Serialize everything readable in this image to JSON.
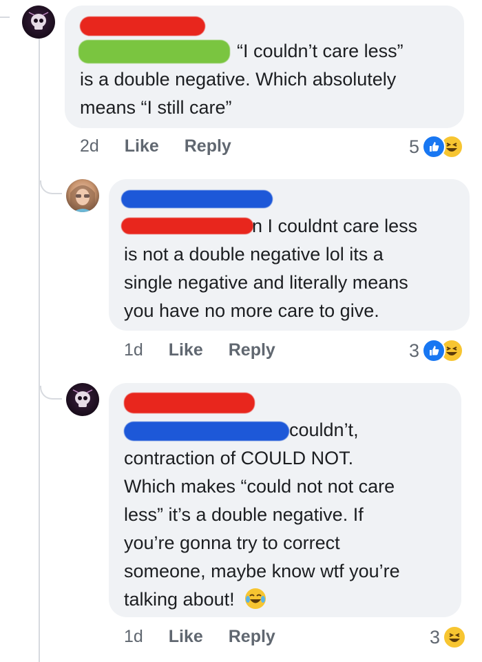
{
  "comments": [
    {
      "text_lines": [
        "“I couldn’t care less”",
        "is a double negative. Which absolutely",
        "means “I still care”"
      ],
      "time": "2d",
      "like_label": "Like",
      "reply_label": "Reply",
      "reaction_count": "5",
      "reactions": [
        "like-icon",
        "haha-icon"
      ]
    },
    {
      "text_lines": [
        "n I couldnt care less",
        "is not a double negative lol its a",
        "single negative and literally means",
        "you have no more care to give."
      ],
      "time": "1d",
      "like_label": "Like",
      "reply_label": "Reply",
      "reaction_count": "3",
      "reactions": [
        "like-icon",
        "haha-icon"
      ]
    },
    {
      "text_lines": [
        "couldn’t,",
        "contraction of COULD NOT.",
        "Which makes “could not not care",
        "less” it’s a double negative. If",
        "you’re gonna try to correct",
        "someone, maybe know wtf you’re",
        "talking about!"
      ],
      "time": "1d",
      "like_label": "Like",
      "reply_label": "Reply",
      "reaction_count": "3",
      "reactions": [
        "haha-icon"
      ],
      "inline_emoji": "tears-of-joy-emoji"
    }
  ],
  "colors": {
    "bubble": "#f0f2f5",
    "redact_red": "#e8261d",
    "redact_green": "#7ac540",
    "redact_blue": "#1d58d8",
    "like_blue": "#1877f2",
    "haha_yellow": "#f7c531",
    "meta_gray": "#606770"
  }
}
